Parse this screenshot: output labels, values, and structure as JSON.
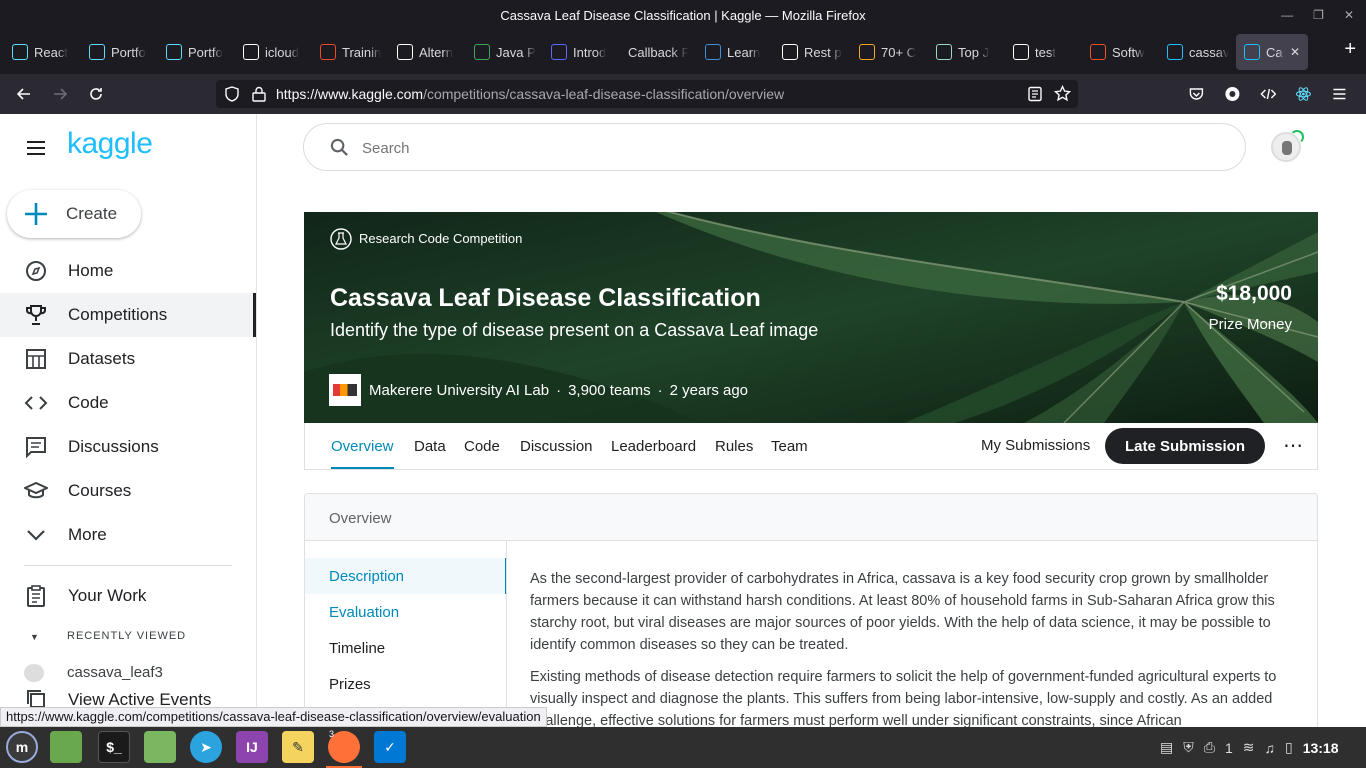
{
  "window": {
    "title": "Cassava Leaf Disease Classification | Kaggle — Mozilla Firefox"
  },
  "tabs": [
    {
      "label": "React",
      "icon": "react-icon",
      "color": "#61dafb"
    },
    {
      "label": "Portfo",
      "icon": "react-icon",
      "color": "#61dafb"
    },
    {
      "label": "Portfo",
      "icon": "react-icon",
      "color": "#61dafb"
    },
    {
      "label": "icloud",
      "icon": "apple-icon",
      "color": "#ffffff"
    },
    {
      "label": "Trainin",
      "icon": "training-icon",
      "color": "#e44d26"
    },
    {
      "label": "Altern",
      "icon": "alternative-icon",
      "color": "#ffffff"
    },
    {
      "label": "Java P",
      "icon": "java-icon",
      "color": "#3aa757"
    },
    {
      "label": "Introd",
      "icon": "intro-icon",
      "color": "#5b6bff"
    },
    {
      "label": "Callback F",
      "icon": "",
      "color": ""
    },
    {
      "label": "Learn",
      "icon": "learn-icon",
      "color": "#3f8fd2"
    },
    {
      "label": "Rest p",
      "icon": "medium-icon",
      "color": "#ffffff"
    },
    {
      "label": "70+ C",
      "icon": "chart-icon",
      "color": "#f5a623"
    },
    {
      "label": "Top J",
      "icon": "mountain-icon",
      "color": "#9cd9c0"
    },
    {
      "label": "test",
      "icon": "copyright-icon",
      "color": "#ffffff"
    },
    {
      "label": "Softw",
      "icon": "microsoft-icon",
      "color": "#f25022"
    },
    {
      "label": "cassav",
      "icon": "kaggle-icon",
      "color": "#20beff"
    },
    {
      "label": "Cas",
      "icon": "kaggle-icon",
      "color": "#20beff",
      "active": true
    }
  ],
  "nav": {
    "url_host": "https://www.kaggle.com",
    "url_path": "/competitions/cassava-leaf-disease-classification/overview"
  },
  "sidebar": {
    "logo": "kaggle",
    "create_label": "Create",
    "items": [
      {
        "label": "Home",
        "icon": "compass-icon"
      },
      {
        "label": "Competitions",
        "icon": "trophy-icon",
        "selected": true
      },
      {
        "label": "Datasets",
        "icon": "table-icon"
      },
      {
        "label": "Code",
        "icon": "code-icon"
      },
      {
        "label": "Discussions",
        "icon": "comment-icon"
      },
      {
        "label": "Courses",
        "icon": "school-icon"
      },
      {
        "label": "More",
        "icon": "chevron-down-icon"
      }
    ],
    "your_work": "Your Work",
    "recently_viewed": "RECENTLY VIEWED",
    "recent_item": "cassava_leaf3",
    "active_events": "View Active Events"
  },
  "search": {
    "placeholder": "Search"
  },
  "competition": {
    "type_label": "Research Code Competition",
    "title": "Cassava Leaf Disease Classification",
    "subtitle": "Identify the type of disease present on a Cassava Leaf image",
    "prize": "$18,000",
    "prize_label": "Prize Money",
    "host": "Makerere University AI Lab",
    "teams": "3,900 teams",
    "when": "2 years ago",
    "sep": "·"
  },
  "comp_tabs": [
    "Overview",
    "Data",
    "Code",
    "Discussion",
    "Leaderboard",
    "Rules",
    "Team"
  ],
  "actions": {
    "my_submissions": "My Submissions",
    "late_submission": "Late Submission",
    "more": "⋯"
  },
  "overview": {
    "header": "Overview",
    "sections": [
      "Description",
      "Evaluation",
      "Timeline",
      "Prizes"
    ],
    "para1": "As the second-largest provider of carbohydrates in Africa, cassava is a key food security crop grown by smallholder farmers because it can withstand harsh conditions. At least 80% of household farms in Sub-Saharan Africa grow this starchy root, but viral diseases are major sources of poor yields. With the help of data science, it may be possible to identify common diseases so they can be treated.",
    "para2": "Existing methods of disease detection require farmers to solicit the help of government-funded agricultural experts to visually inspect and diagnose the plants. This suffers from being labor-intensive, low-supply and costly. As an added challenge, effective solutions for farmers must perform well under significant constraints, since African"
  },
  "status_url": "https://www.kaggle.com/competitions/cassava-leaf-disease-classification/overview/evaluation",
  "taskbar": {
    "clock": "13:18",
    "badge": "3",
    "printer_count": "1"
  }
}
